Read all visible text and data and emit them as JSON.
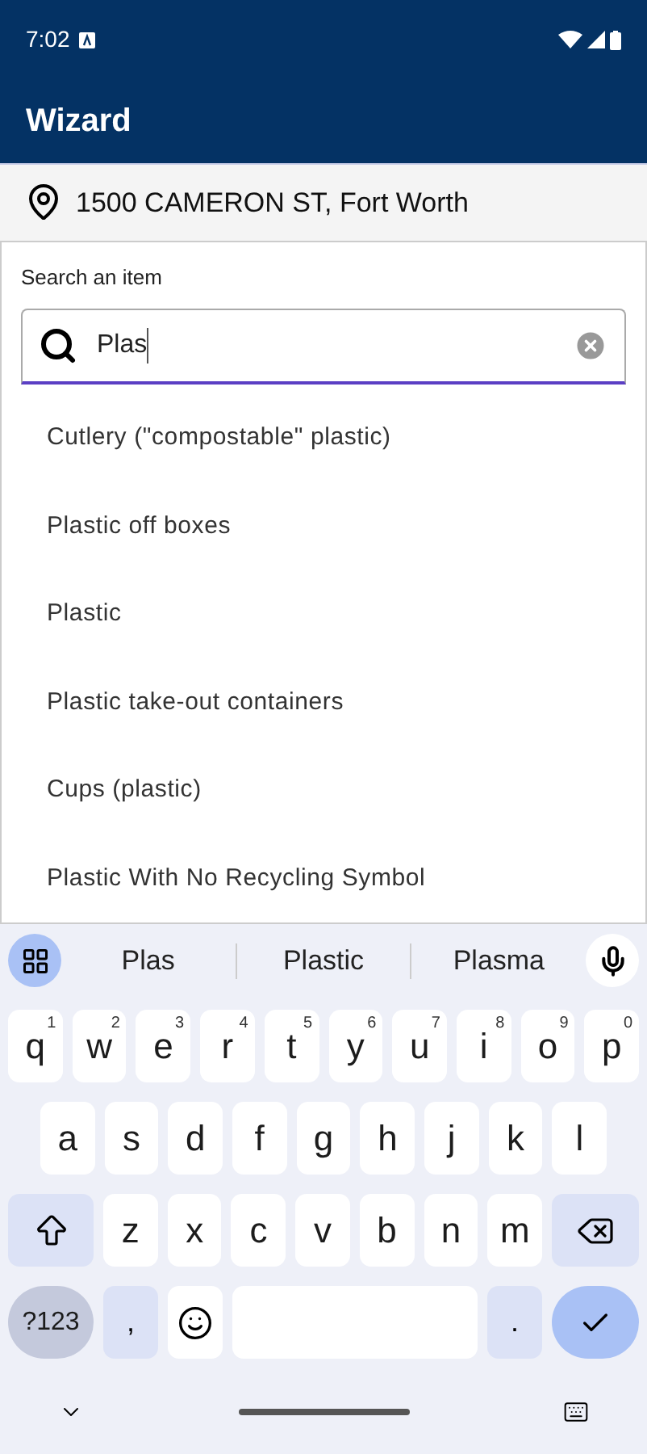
{
  "status_bar": {
    "time": "7:02"
  },
  "app_bar": {
    "title": "Wizard"
  },
  "address": {
    "text": "1500 CAMERON ST, Fort Worth"
  },
  "search": {
    "label": "Search an item",
    "value": "Plas",
    "focused": true
  },
  "results": [
    {
      "text": "Cutlery (\"compostable\" plastic)"
    },
    {
      "text": "Plastic off boxes"
    },
    {
      "text": "Plastic"
    },
    {
      "text": "Plastic take-out containers"
    },
    {
      "text": "Cups (plastic)"
    },
    {
      "text": "Plastic With No Recycling Symbol"
    }
  ],
  "keyboard": {
    "suggestions": [
      "Plas",
      "Plastic",
      "Plasma"
    ],
    "rows": [
      {
        "keys": [
          {
            "kind": "letter",
            "label": "q",
            "hint": "1"
          },
          {
            "kind": "letter",
            "label": "w",
            "hint": "2"
          },
          {
            "kind": "letter",
            "label": "e",
            "hint": "3"
          },
          {
            "kind": "letter",
            "label": "r",
            "hint": "4"
          },
          {
            "kind": "letter",
            "label": "t",
            "hint": "5"
          },
          {
            "kind": "letter",
            "label": "y",
            "hint": "6"
          },
          {
            "kind": "letter",
            "label": "u",
            "hint": "7"
          },
          {
            "kind": "letter",
            "label": "i",
            "hint": "8"
          },
          {
            "kind": "letter",
            "label": "o",
            "hint": "9"
          },
          {
            "kind": "letter",
            "label": "p",
            "hint": "0"
          }
        ]
      },
      {
        "keys": [
          {
            "kind": "letter",
            "label": "a"
          },
          {
            "kind": "letter",
            "label": "s"
          },
          {
            "kind": "letter",
            "label": "d"
          },
          {
            "kind": "letter",
            "label": "f"
          },
          {
            "kind": "letter",
            "label": "g"
          },
          {
            "kind": "letter",
            "label": "h"
          },
          {
            "kind": "letter",
            "label": "j"
          },
          {
            "kind": "letter",
            "label": "k"
          },
          {
            "kind": "letter",
            "label": "l"
          }
        ]
      },
      {
        "keys": [
          {
            "kind": "shift"
          },
          {
            "kind": "letter",
            "label": "z"
          },
          {
            "kind": "letter",
            "label": "x"
          },
          {
            "kind": "letter",
            "label": "c"
          },
          {
            "kind": "letter",
            "label": "v"
          },
          {
            "kind": "letter",
            "label": "b"
          },
          {
            "kind": "letter",
            "label": "n"
          },
          {
            "kind": "letter",
            "label": "m"
          },
          {
            "kind": "backspace"
          }
        ]
      },
      {
        "keys": [
          {
            "kind": "symbols",
            "label": "?123"
          },
          {
            "kind": "punct",
            "label": ","
          },
          {
            "kind": "emoji"
          },
          {
            "kind": "space"
          },
          {
            "kind": "punct",
            "label": "."
          },
          {
            "kind": "enter"
          }
        ]
      }
    ]
  }
}
